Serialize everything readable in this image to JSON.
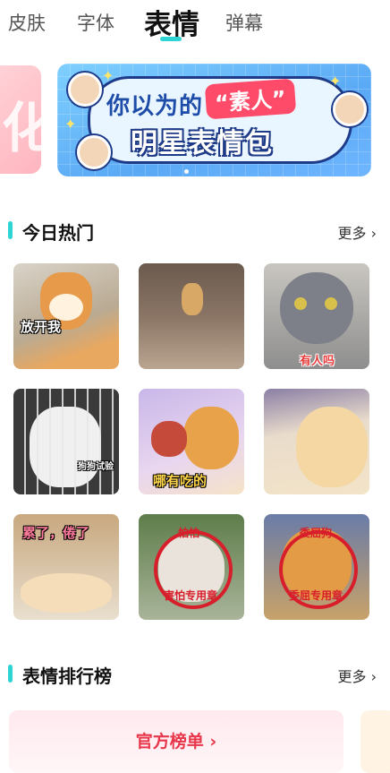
{
  "tabs": [
    "皮肤",
    "字体",
    "表情",
    "弹幕"
  ],
  "active_tab": "表情",
  "banner": {
    "line1": "你以为的",
    "quote": "“素人”",
    "line2": "明星表情包",
    "peek_char": "化"
  },
  "section_hot": {
    "title": "今日热门",
    "more": "更多 ›"
  },
  "stickers": [
    {
      "caption": "放开我"
    },
    {
      "caption": ""
    },
    {
      "caption": "有人吗"
    },
    {
      "caption": "狗狗试验"
    },
    {
      "caption": "哪有吃的"
    },
    {
      "caption": ""
    },
    {
      "caption": "累了，倦了"
    },
    {
      "caption": "害怕专用章",
      "stamp_top": "怕怕",
      "stamp_bottom": "害怕专用章"
    },
    {
      "caption": "委屈专用章",
      "stamp_top": "委屈狗",
      "stamp_bottom": "委屈专用章"
    }
  ],
  "section_rank": {
    "title": "表情排行榜",
    "more": "更多 ›"
  },
  "rank_card": {
    "label": "官方榜单 ›"
  },
  "colors": {
    "accent": "#2fd4d4",
    "rank_text": "#e8364a",
    "stamp": "#d81e2b"
  }
}
